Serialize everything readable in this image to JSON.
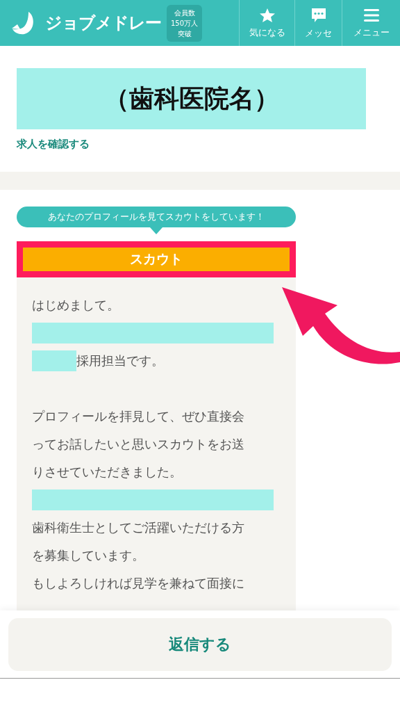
{
  "header": {
    "logo": "ジョブメドレー",
    "badge": [
      "会員数",
      "150万人",
      "突破"
    ],
    "nav": [
      {
        "kind": "star",
        "label": "気になる"
      },
      {
        "kind": "chat",
        "label": "メッセ"
      },
      {
        "kind": "menu",
        "label": "メニュー"
      }
    ]
  },
  "clinic": {
    "name": "（歯科医院名）",
    "link": "求人を確認する"
  },
  "scout": {
    "bubble": "あなたのプロフィールを見てスカウトをしています！",
    "title": "スカウト",
    "lines": [
      {
        "kind": "text",
        "text": "はじめまして。"
      },
      {
        "kind": "redacted"
      },
      {
        "kind": "redacted_prefix",
        "text": "採用担当です。"
      },
      {
        "kind": "blank"
      },
      {
        "kind": "text",
        "text": "プロフィールを拝見して、ぜひ直接会"
      },
      {
        "kind": "text",
        "text": "ってお話したいと思いスカウトをお送"
      },
      {
        "kind": "text",
        "text": "りさせていただきました。"
      },
      {
        "kind": "redacted"
      },
      {
        "kind": "text",
        "text": "歯科衛生士としてご活躍いただける方"
      },
      {
        "kind": "text",
        "text": "を募集しています。"
      },
      {
        "kind": "text",
        "text": "もしよろしければ見学を兼ねて面接に"
      }
    ]
  },
  "reply_button": "返信する"
}
